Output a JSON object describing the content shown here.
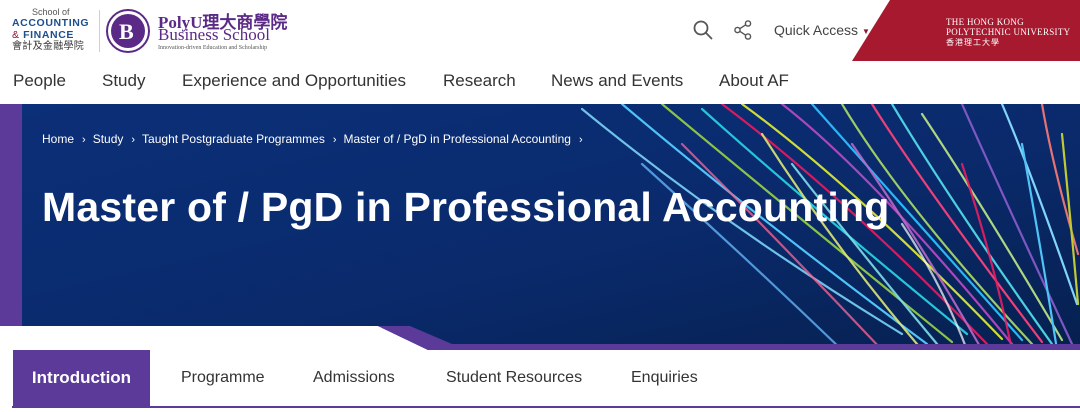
{
  "header": {
    "af_logo": {
      "line1": "School of",
      "line2": "ACCOUNTING",
      "line3_amp": "&",
      "line3": "FINANCE",
      "line4": "會計及金融學院"
    },
    "pbs_logo": {
      "letter": "B",
      "line1": "PolyU理大商學院",
      "line2": "Business School",
      "tagline": "Innovation-driven Education and Scholarship"
    },
    "search_icon": "search-icon",
    "share_icon": "share-icon",
    "quick_access_label": "Quick Access",
    "quick_access_caret": "▼",
    "polyu": {
      "line1": "THE HONG KONG",
      "line2": "POLYTECHNIC UNIVERSITY",
      "line3": "香港理工大學",
      "color": "#a6192e"
    }
  },
  "nav": {
    "items": [
      "People",
      "Study",
      "Experience and Opportunities",
      "Research",
      "News and Events",
      "About AF"
    ]
  },
  "hero": {
    "breadcrumb": [
      "Home",
      "Study",
      "Taught Postgraduate Programmes",
      "Master of / PgD in Professional Accounting"
    ],
    "breadcrumb_sep": "›",
    "title": "Master of / PgD in Professional Accounting"
  },
  "tabs": {
    "items": [
      "Introduction",
      "Programme",
      "Admissions",
      "Student Resources",
      "Enquiries"
    ],
    "active": "Introduction"
  },
  "colors": {
    "accent_purple": "#5b3a9a",
    "brand_maroon": "#a6192e",
    "hero_navy": "#0a2a6c"
  }
}
